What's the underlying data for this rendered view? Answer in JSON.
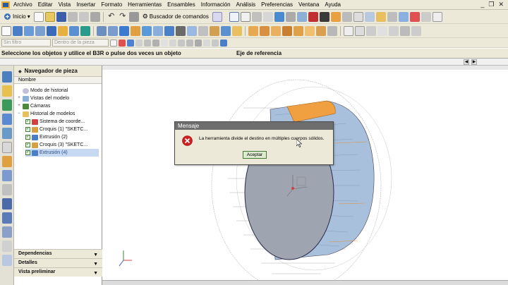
{
  "menubar": {
    "items": [
      "Archivo",
      "Editar",
      "Vista",
      "Insertar",
      "Formato",
      "Herramientas",
      "Ensambles",
      "Información",
      "Análisis",
      "Preferencias",
      "Ventana",
      "Ayuda"
    ]
  },
  "toolbar": {
    "start_label": "Inicio",
    "command_finder_label": "Buscador de comandos",
    "filter_combo": "Sin filtro",
    "scope_combo": "Dentro de la pieza"
  },
  "statusbar": {
    "prompt": "Seleccione los objetos y utilice el B3R o pulse dos veces un objeto",
    "status": "Eje de referencia"
  },
  "navigator": {
    "title": "Navegador de pieza",
    "column_header": "Nombre",
    "nodes": [
      {
        "label": "Modo de historial"
      },
      {
        "label": "Vistas del modelo"
      },
      {
        "label": "Cámaras"
      },
      {
        "label": "Historial de modelos"
      },
      {
        "label": "Sistema de coorde..."
      },
      {
        "label": "Croquis (1) \"SKETC..."
      },
      {
        "label": "Extrusión (2)"
      },
      {
        "label": "Croquis (3) \"SKETC..."
      },
      {
        "label": "Extrusión (4)"
      }
    ],
    "bottom_panels": [
      "Dependencias",
      "Detalles",
      "Vista preliminar"
    ]
  },
  "dialog": {
    "title": "Mensaje",
    "message": "La herramienta divide el destino en múltiples cuerpos sólidos.",
    "ok_label": "Aceptar"
  },
  "colors": {
    "error_red": "#d11f1f",
    "selection_blue": "#c7d9f2",
    "part_blue": "#a9c0dc",
    "part_orange": "#f0a040",
    "dialog_title": "#6e6e6e"
  }
}
